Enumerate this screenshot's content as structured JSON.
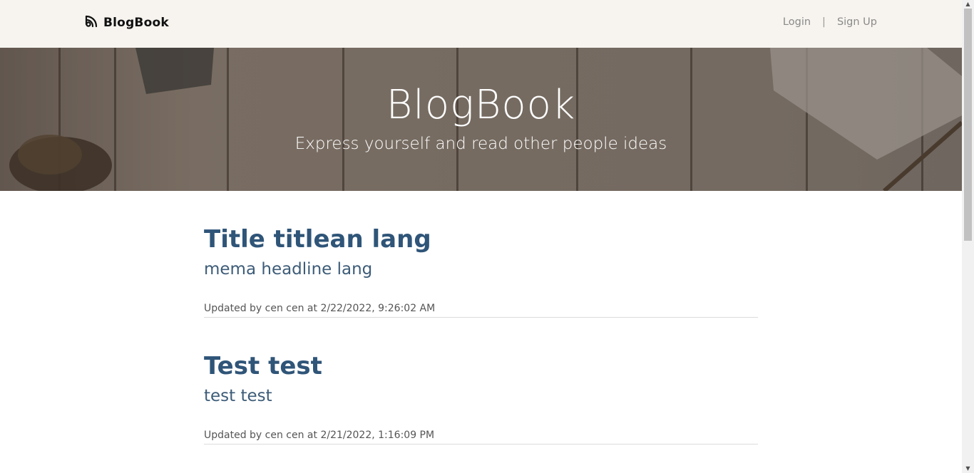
{
  "nav": {
    "brand": "BlogBook",
    "login": "Login",
    "separator": "|",
    "signup": "Sign Up"
  },
  "hero": {
    "title": "BlogBook",
    "subtitle": "Express yourself and read other people ideas"
  },
  "posts": [
    {
      "title": "Title titlean lang",
      "headline": "mema headline lang",
      "meta": "Updated by cen cen at 2/22/2022, 9:26:02 AM"
    },
    {
      "title": "Test test",
      "headline": "test test",
      "meta": "Updated by cen cen at 2/21/2022, 1:16:09 PM"
    }
  ],
  "colors": {
    "navbar_bg": "#f7f4ef",
    "post_title": "#2f5578",
    "post_headline": "#3d5c78"
  },
  "icons": {
    "brand": "rss-feed-icon"
  }
}
